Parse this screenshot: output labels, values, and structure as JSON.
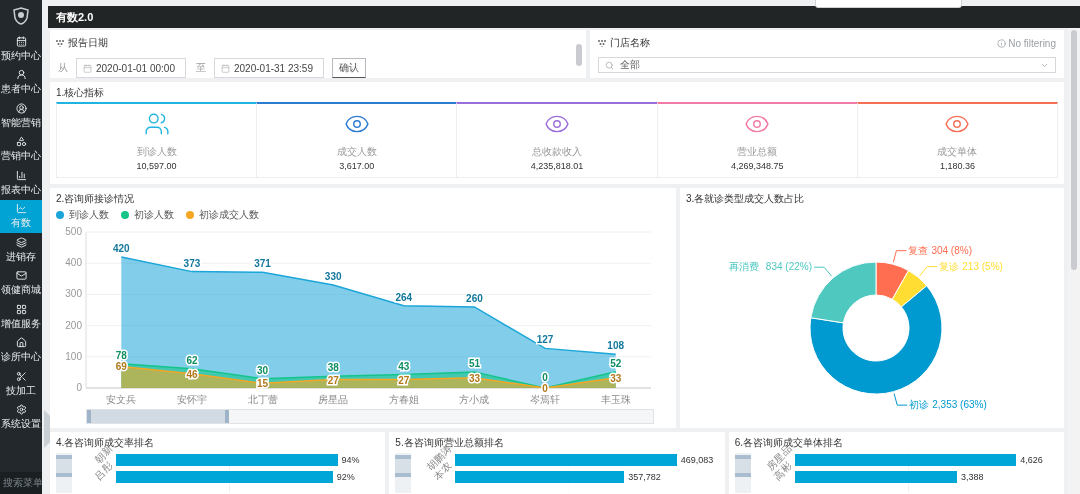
{
  "sidebar": {
    "items": [
      {
        "label": "预约中心",
        "selected": false
      },
      {
        "label": "患者中心",
        "selected": false
      },
      {
        "label": "智能营销",
        "selected": false
      },
      {
        "label": "营销中心",
        "selected": false
      },
      {
        "label": "报表中心",
        "selected": false
      },
      {
        "label": "有数",
        "selected": true
      },
      {
        "label": "进销存",
        "selected": false
      },
      {
        "label": "领健商城",
        "selected": false
      },
      {
        "label": "增值服务",
        "selected": false
      },
      {
        "label": "诊所中心",
        "selected": false
      },
      {
        "label": "技加工",
        "selected": false
      },
      {
        "label": "系统设置",
        "selected": false
      }
    ],
    "search": {
      "placeholder": "搜索菜单"
    }
  },
  "header": {
    "title": "有数2.0"
  },
  "filters": {
    "date": {
      "label": "报告日期",
      "from_label": "从",
      "from": "2020-01-01 00:00",
      "to_label": "至",
      "to": "2020-01-31 23:59",
      "confirm": "确认"
    },
    "store": {
      "label": "门店名称",
      "status": "No filtering",
      "value": "全部"
    }
  },
  "metrics": {
    "title": "1.核心指标",
    "items": [
      {
        "kind": "people",
        "label": "到诊人数",
        "value": "10,597.00",
        "color": "#1fb5e0"
      },
      {
        "kind": "eye",
        "label": "成交人数",
        "value": "3,617.00",
        "color": "#2b7bd0"
      },
      {
        "kind": "eye",
        "label": "总收款收入",
        "value": "4,235,818.01",
        "color": "#9a6ed8"
      },
      {
        "kind": "eye",
        "label": "营业总额",
        "value": "4,269,348.75",
        "color": "#f27aa6"
      },
      {
        "kind": "eye",
        "label": "成交单体",
        "value": "1,180.36",
        "color": "#f56f55"
      }
    ]
  },
  "consult": {
    "title": "2.咨询师接诊情况",
    "zoom_slider": {
      "level": 0.25
    },
    "chart_data": {
      "type": "area",
      "grid": true,
      "categories": [
        "安文兵",
        "安怀宇",
        "北丁蕾",
        "房星品",
        "方春姐",
        "方小成",
        "岑焉轩",
        "丰玉珠"
      ],
      "ylim": [
        0,
        500
      ],
      "yticks": [
        0,
        100,
        200,
        300,
        400,
        500
      ],
      "data_labels": true,
      "series": [
        {
          "name": "到诊人数",
          "color": "#1ba5d8",
          "values": [
            420,
            373,
            371,
            330,
            264,
            260,
            127,
            108
          ]
        },
        {
          "name": "初诊人数",
          "color": "#14c48a",
          "values": [
            78,
            62,
            30,
            38,
            43,
            51,
            0,
            52
          ]
        },
        {
          "name": "初诊成交人数",
          "color": "#f5a623",
          "values": [
            69,
            46,
            15,
            27,
            27,
            33,
            0,
            33
          ]
        }
      ]
    }
  },
  "ratio": {
    "title": "3.各就诊类型成交人数占比",
    "chart_data": {
      "type": "donut",
      "categories": [
        "复查",
        "复诊",
        "初诊",
        "再消费"
      ],
      "values": [
        304,
        213,
        2353,
        834
      ],
      "value_labels": [
        "304 (8%)",
        "213 (5%)",
        "2,353 (63%)",
        "834 (22%)"
      ]
    }
  },
  "rankings": [
    {
      "title": "4.各咨询师成交率排名",
      "zoom_slider": {
        "level": 0.6
      },
      "chart_data": {
        "type": "bar",
        "orientation": "horizontal",
        "categories": [
          "朝新",
          "吕彤"
        ],
        "values": [
          94,
          92
        ],
        "value_labels": [
          "94%",
          "92%"
        ]
      }
    },
    {
      "title": "5.各咨询师营业总额排名",
      "zoom_slider": {
        "level": 0.6
      },
      "chart_data": {
        "type": "bar",
        "orientation": "horizontal",
        "categories": [
          "胡鹏涛",
          "本农"
        ],
        "values": [
          469083,
          357782
        ],
        "value_labels": [
          "469,083",
          "357,782"
        ]
      }
    },
    {
      "title": "6.各咨询师成交单体排名",
      "zoom_slider": {
        "level": 0.6
      },
      "chart_data": {
        "type": "bar",
        "orientation": "horizontal",
        "categories": [
          "房星品",
          "高彬"
        ],
        "values": [
          4626,
          3388
        ],
        "value_labels": [
          "4,626",
          "3,388"
        ]
      }
    }
  ]
}
